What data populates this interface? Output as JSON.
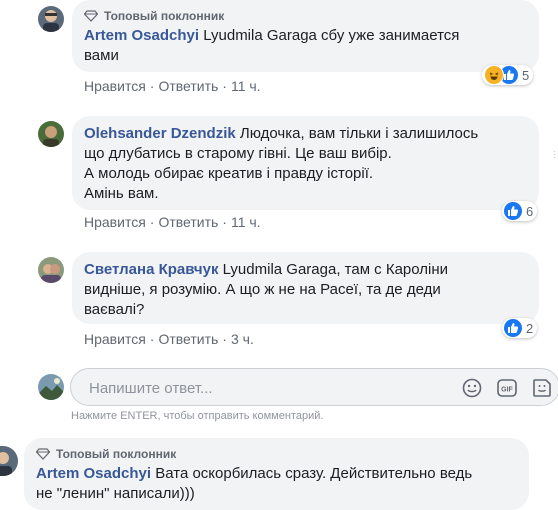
{
  "badge_label": "Топовый поклонник",
  "comments": [
    {
      "author": "Artem Osadchyi",
      "lines": [
        "Lyudmila Garaga сбу уже занимается",
        "вами"
      ],
      "like": "Нравится",
      "reply": "Ответить",
      "time": "11 ч.",
      "reactions_count": "5"
    },
    {
      "author": "Olehsander Dzendzik",
      "lines": [
        "Людочка, вам тільки і залишилось",
        "що длубатись в старому гівні. Це ваш вибір.",
        "А молодь обирає креатив і правду історії.",
        "Амінь вам."
      ],
      "like": "Нравится",
      "reply": "Ответить",
      "time": "11 ч.",
      "reactions_count": "6"
    },
    {
      "author": "Светлана Кравчук",
      "lines": [
        "Lyudmila Garaga, там с Кароліни",
        "видніше, я розумію. А що ж не на Расеї, та де деди",
        "ваєвалі?"
      ],
      "like": "Нравится",
      "reply": "Ответить",
      "time": "3 ч.",
      "reactions_count": "2"
    },
    {
      "author": "Artem Osadchyi",
      "lines": [
        "Вата оскорбилась сразу. Действительно ведь",
        "не \"ленин\" написали)))"
      ]
    }
  ],
  "reply_input": {
    "placeholder": "Напишите ответ...",
    "hint": "Нажмите ENTER, чтобы отправить комментарий."
  }
}
